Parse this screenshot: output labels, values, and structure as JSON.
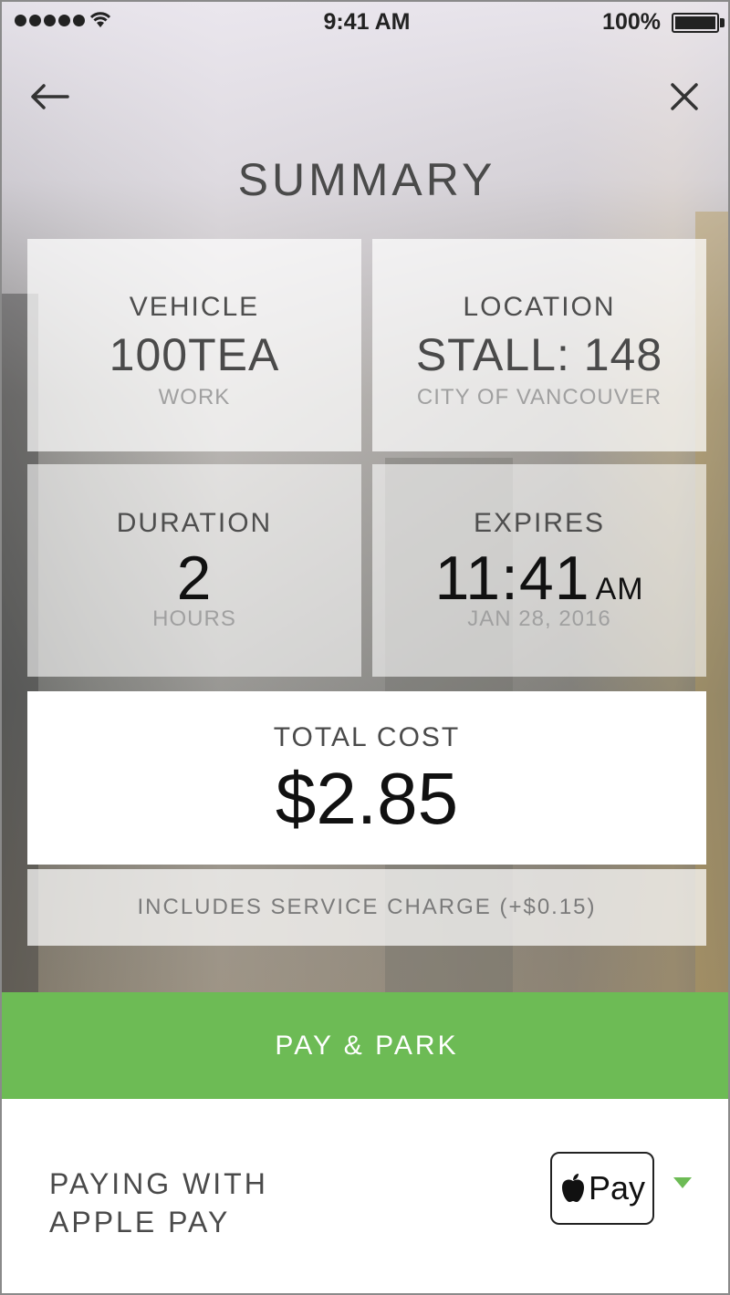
{
  "status_bar": {
    "time": "9:41 AM",
    "battery": "100%"
  },
  "nav": {
    "back_icon": "arrow-left-icon",
    "close_icon": "close-icon"
  },
  "title": "SUMMARY",
  "cards": {
    "vehicle": {
      "label": "VEHICLE",
      "value": "100TEA",
      "sub": "WORK"
    },
    "location": {
      "label": "LOCATION",
      "value": "STALL: 148",
      "sub": "CITY OF VANCOUVER"
    },
    "duration": {
      "label": "DURATION",
      "value": "2",
      "sub": "HOURS"
    },
    "expires": {
      "label": "EXPIRES",
      "value": "11:41",
      "ampm": "AM",
      "sub": "JAN 28, 2016"
    }
  },
  "total": {
    "label": "TOTAL COST",
    "value": "$2.85",
    "service_note": "INCLUDES SERVICE CHARGE (+$0.15)"
  },
  "action": {
    "pay_label": "PAY & PARK",
    "color": "#6dbb55"
  },
  "payment": {
    "line1": "PAYING WITH",
    "line2": "APPLE PAY",
    "badge_text": "Pay",
    "badge_icon": "apple-logo-icon"
  }
}
